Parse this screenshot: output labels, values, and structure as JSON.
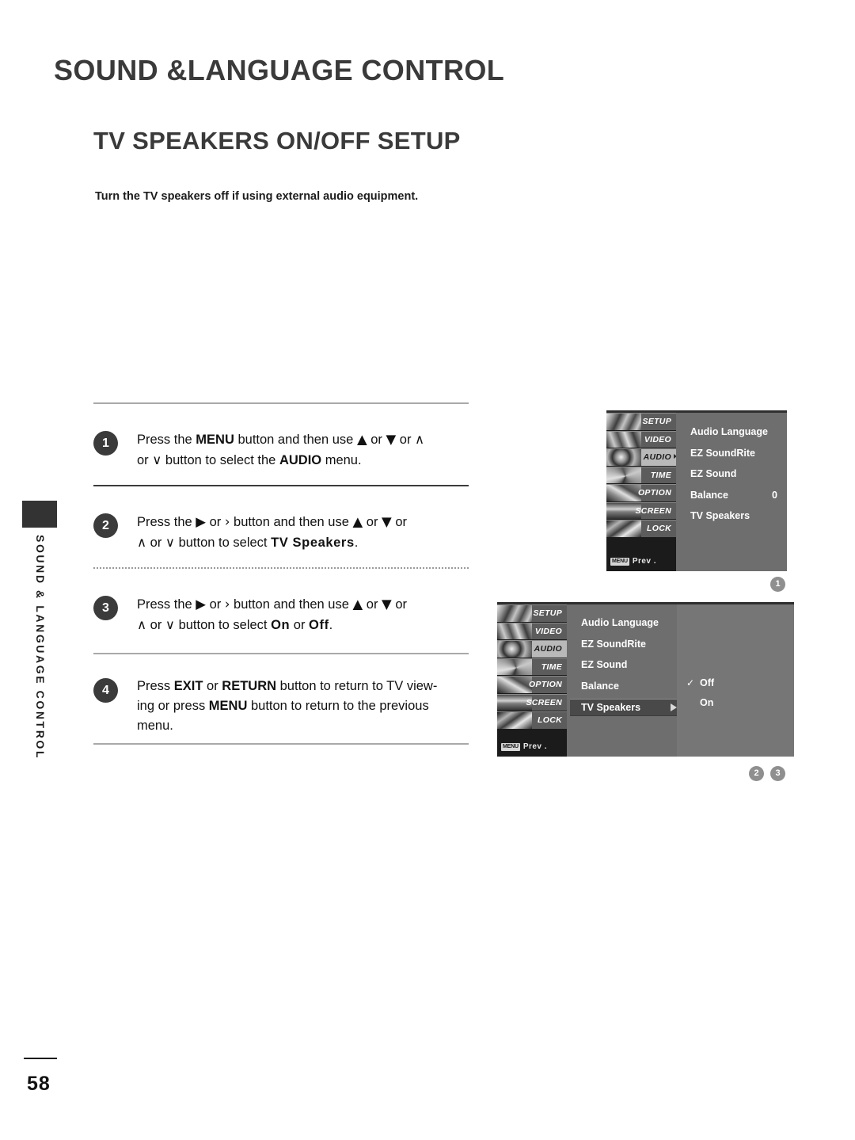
{
  "document": {
    "chapter_title": "SOUND &LANGUAGE CONTROL",
    "section_title": "TV SPEAKERS ON/OFF SETUP",
    "intro_text": "Turn the TV speakers off if using external audio equipment.",
    "page_number": "58",
    "sidebar_label": "SOUND & LANGUAGE CONTROL"
  },
  "steps": [
    {
      "number": "1",
      "line1_a": "Press the ",
      "line1_bold1": "MENU",
      "line1_b": " button and then use ",
      "line1_up": "▲",
      "line1_c": " or ",
      "line1_down": "▼",
      "line1_d": "  or  ",
      "line1_caretup": "∧",
      "line2_a": "or ",
      "line2_caretdown": "∨",
      "line2_b": "  button to select the ",
      "line2_bold": "AUDIO",
      "line2_c": " menu."
    },
    {
      "number": "2",
      "line1_a": "Press the ",
      "line1_right": "▶",
      "line1_b": "  or  ",
      "line1_gt": "›",
      "line1_c": "  button and then use ",
      "line1_up": "▲",
      "line1_d": " or ",
      "line1_down": "▼",
      "line1_e": "  or",
      "line2_caretup": "∧",
      "line2_a": " or ",
      "line2_caretdown": "∨",
      "line2_b": "  button to select ",
      "line2_bold": "TV Speakers",
      "line2_c": "."
    },
    {
      "number": "3",
      "line1_a": "Press the ",
      "line1_right": "▶",
      "line1_b": "  or  ",
      "line1_gt": "›",
      "line1_c": "  button and then use ",
      "line1_up": "▲",
      "line1_d": " or ",
      "line1_down": "▼",
      "line1_e": "  or",
      "line2_caretup": "∧",
      "line2_a": " or ",
      "line2_caretdown": "∨",
      "line2_b": "  button to select ",
      "line2_bold1": "On",
      "line2_c": " or ",
      "line2_bold2": "Off",
      "line2_d": "."
    },
    {
      "number": "4",
      "line1_a": "Press ",
      "line1_bold1": "EXIT",
      "line1_b": " or ",
      "line1_bold2": "RETURN",
      "line1_c": " button to return to TV view-",
      "line2_a": "ing or press ",
      "line2_bold": "MENU",
      "line2_b": " button to return to the previous",
      "line3": "menu."
    }
  ],
  "osd": {
    "nav_items": [
      {
        "label": "SETUP",
        "selected": false
      },
      {
        "label": "VIDEO",
        "selected": false
      },
      {
        "label": "AUDIO",
        "selected": true
      },
      {
        "label": "TIME",
        "selected": false
      },
      {
        "label": "OPTION",
        "selected": false
      },
      {
        "label": "SCREEN",
        "selected": false
      },
      {
        "label": "LOCK",
        "selected": false
      }
    ],
    "prev_key": "MENU",
    "prev_label": "Prev .",
    "menu1": {
      "rows": [
        {
          "label": "Audio Language",
          "value": ""
        },
        {
          "label": "EZ SoundRite",
          "value": ""
        },
        {
          "label": "EZ Sound",
          "value": ""
        },
        {
          "label": "Balance",
          "value": "0"
        },
        {
          "label": "TV Speakers",
          "value": ""
        }
      ],
      "marker": "1"
    },
    "menu2": {
      "rows": [
        {
          "label": "Audio Language",
          "highlight": false
        },
        {
          "label": "EZ SoundRite",
          "highlight": false
        },
        {
          "label": "EZ Sound",
          "highlight": false
        },
        {
          "label": "Balance",
          "highlight": false
        },
        {
          "label": "TV Speakers",
          "highlight": true
        }
      ],
      "submenu": [
        {
          "label": "Off",
          "checked": true,
          "check_glyph": "✓"
        },
        {
          "label": "On",
          "checked": false,
          "check_glyph": ""
        }
      ],
      "markers": [
        "2",
        "3"
      ]
    }
  },
  "colors": {
    "heading": "#3a3a3a",
    "osd_bg": "#6e6e6e",
    "osd_sub_bg": "#767676",
    "osd_highlight": "#494949",
    "osd_nav": "#5c5c5c",
    "osd_nav_selected": "#b9b9b9",
    "badge": "#3b3b3b",
    "marker": "#8f8f8f"
  }
}
